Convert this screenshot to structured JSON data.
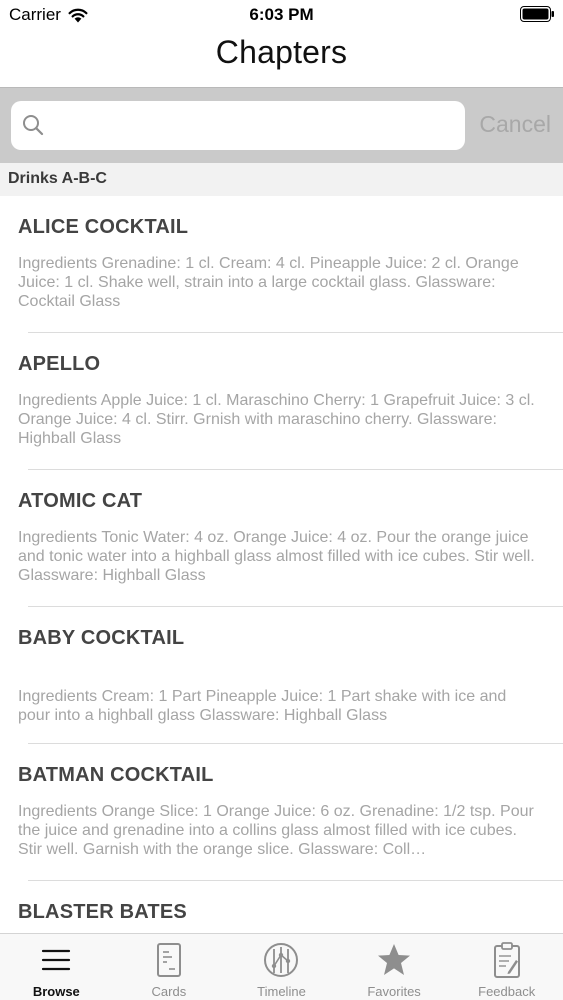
{
  "status_bar": {
    "carrier": "Carrier",
    "time": "6:03 PM"
  },
  "nav": {
    "title": "Chapters"
  },
  "search": {
    "placeholder": "",
    "cancel_label": "Cancel"
  },
  "section": {
    "title": "Drinks A-B-C"
  },
  "items": [
    {
      "title": "ALICE COCKTAIL",
      "description": "Ingredients Grenadine: 1 cl. Cream: 4 cl. Pineapple Juice: 2 cl. Orange Juice: 1 cl. Shake well, strain into a large cocktail glass. Glassware: Cocktail Glass"
    },
    {
      "title": "APELLO",
      "description": "Ingredients Apple Juice: 1 cl. Maraschino Cherry: 1 Grapefruit Juice: 3 cl. Orange Juice: 4 cl. Stirr. Grnish with maraschino cherry. Glassware: Highball Glass"
    },
    {
      "title": "ATOMIC CAT",
      "description": "Ingredients Tonic Water: 4 oz. Orange Juice: 4 oz. Pour the orange juice and tonic water into a highball glass almost filled with ice cubes. Stir well. Glassware: Highball Glass"
    },
    {
      "title": "BABY COCKTAIL",
      "description": "Ingredients Cream: 1 Part Pineapple Juice: 1 Part shake with ice and pour into a highball glass Glassware: Highball Glass"
    },
    {
      "title": "BATMAN COCKTAIL",
      "description": "Ingredients Orange Slice: 1 Orange Juice: 6 oz. Grenadine: 1/2 tsp. Pour the juice and grenadine into a collins glass almost filled with ice cubes. Stir well. Garnish with the orange slice. Glassware: Coll…"
    },
    {
      "title": "BLASTER BATES",
      "description": ""
    }
  ],
  "tabs": [
    {
      "label": "Browse",
      "icon": "list-icon",
      "active": true
    },
    {
      "label": "Cards",
      "icon": "card-icon",
      "active": false
    },
    {
      "label": "Timeline",
      "icon": "timeline-icon",
      "active": false
    },
    {
      "label": "Favorites",
      "icon": "star-icon",
      "active": false
    },
    {
      "label": "Feedback",
      "icon": "clipboard-icon",
      "active": false
    }
  ],
  "colors": {
    "active_tab": "#111111",
    "inactive_tab": "#8e8e8e",
    "search_bg": "#cacaca",
    "cancel": "#a8a8a8"
  }
}
